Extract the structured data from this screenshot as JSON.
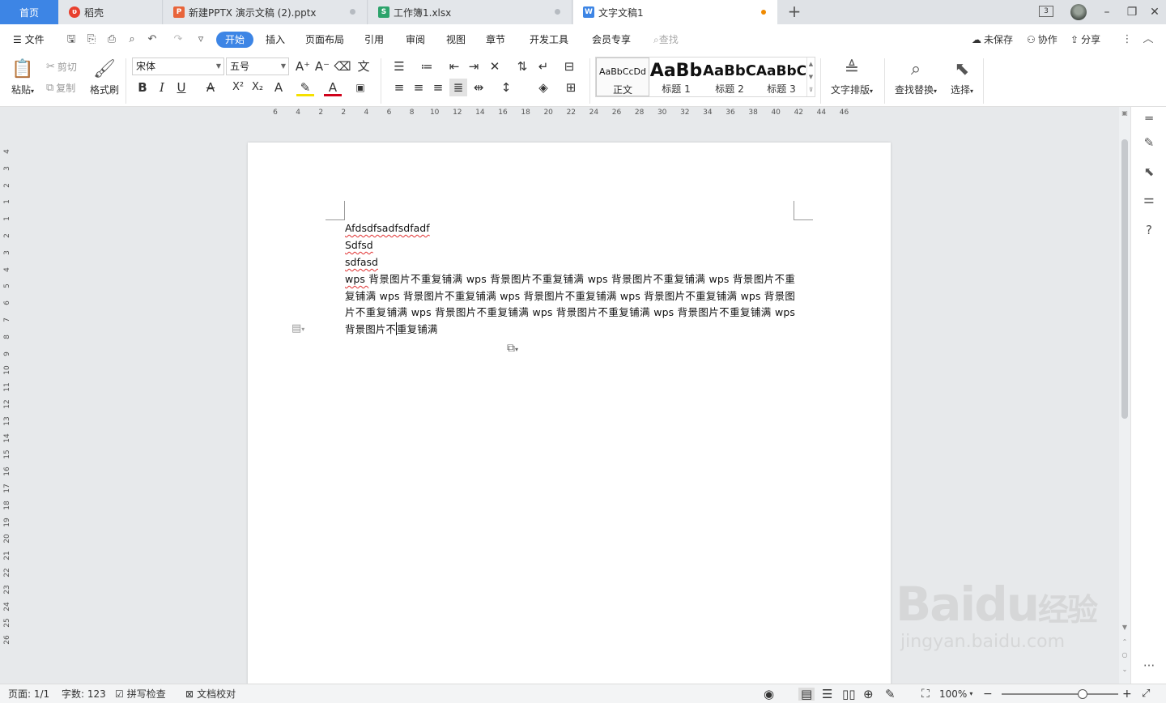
{
  "tabs": [
    {
      "label": "首页",
      "type": "home"
    },
    {
      "label": "稻壳",
      "icon": "daoke-icon",
      "color": "#e8402e"
    },
    {
      "label": "新建PPTX 演示文稿 (2).pptx",
      "icon": "ppt-icon",
      "color": "#e8643a"
    },
    {
      "label": "工作簿1.xlsx",
      "icon": "xls-icon",
      "color": "#2ca36b"
    },
    {
      "label": "文字文稿1",
      "icon": "word-icon",
      "color": "#3d85e5",
      "active": true,
      "unsaved": true
    }
  ],
  "window": {
    "window_count": "3"
  },
  "menu": {
    "file": "文件",
    "tabs": [
      "开始",
      "插入",
      "页面布局",
      "引用",
      "审阅",
      "视图",
      "章节",
      "开发工具",
      "会员专享"
    ],
    "search_placeholder": "查找",
    "unsaved": "未保存",
    "collab": "协作",
    "share": "分享"
  },
  "ribbon": {
    "paste": "粘贴",
    "cut": "剪切",
    "copy": "复制",
    "format_painter": "格式刷",
    "font_name": "宋体",
    "font_size": "五号",
    "styles": [
      {
        "preview": "AaBbCcDd",
        "name": "正文"
      },
      {
        "preview": "AaBb",
        "name": "标题 1"
      },
      {
        "preview": "AaBbC",
        "name": "标题 2"
      },
      {
        "preview": "AaBbC",
        "name": "标题 3"
      }
    ],
    "text_layout": "文字排版",
    "find_replace": "查找替换",
    "select": "选择"
  },
  "ruler": {
    "h_ticks": [
      "6",
      "4",
      "2",
      "2",
      "4",
      "6",
      "8",
      "10",
      "12",
      "14",
      "16",
      "18",
      "20",
      "22",
      "24",
      "26",
      "28",
      "30",
      "32",
      "34",
      "36",
      "38",
      "40",
      "42",
      "44",
      "46"
    ],
    "v_ticks": [
      "4",
      "3",
      "2",
      "1",
      "1",
      "2",
      "3",
      "4",
      "5",
      "6",
      "7",
      "8",
      "9",
      "10",
      "11",
      "12",
      "13",
      "14",
      "15",
      "16",
      "17",
      "18",
      "19",
      "20",
      "21",
      "22",
      "23",
      "24",
      "25",
      "26"
    ]
  },
  "document": {
    "line1": "Afdsdfsadfsdfadf",
    "line2": "Sdfsd",
    "line3": "sdfasd",
    "body_before_cursor": "背景图片不重复铺满 wps 背景图片不重复铺满 wps 背景图片不重复铺满 wps 背景图片不重复铺满 wps 背景图片不重复铺满 wps 背景图片不重复铺满 wps 背景图片不重复铺满 wps 背景图片不重复铺满 wps 背景图片不重复铺满 wps 背景图片不重复铺满 wps 背景图片不重复铺满 wps 背景图片不",
    "body_prefix": "wps ",
    "body_after_cursor": "重复铺满"
  },
  "status": {
    "page": "页面: 1/1",
    "words": "字数: 123",
    "spell": "拼写检查",
    "proof": "文档校对",
    "zoom": "100%",
    "zoom_level_percent": 100
  },
  "watermark": {
    "brand": "Baidu",
    "cn": "经验",
    "url": "jingyan.baidu.com"
  },
  "colors": {
    "accent": "#3d85e5",
    "unsaved_dot": "#f08a00",
    "squiggle": "#e03030"
  }
}
